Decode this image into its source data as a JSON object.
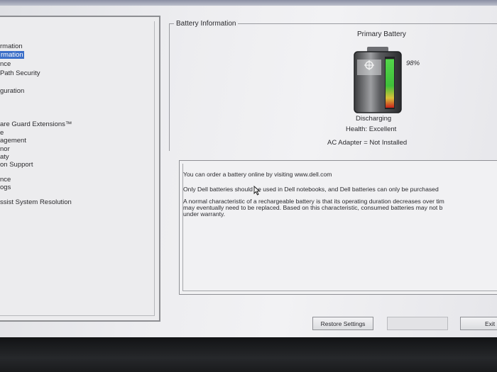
{
  "nav": {
    "items": [
      {
        "label": "rmation",
        "selected": false
      },
      {
        "label": "rmation",
        "selected": true
      },
      {
        "label": "nce",
        "selected": false
      },
      {
        "label": "Path Security",
        "selected": false
      },
      {
        "label": "guration",
        "selected": false
      },
      {
        "label": "are Guard Extensions™",
        "selected": false
      },
      {
        "label": "e",
        "selected": false
      },
      {
        "label": "agement",
        "selected": false
      },
      {
        "label": "nor",
        "selected": false
      },
      {
        "label": "aty",
        "selected": false
      },
      {
        "label": "on Support",
        "selected": false
      },
      {
        "label": "nce",
        "selected": false
      },
      {
        "label": "ogs",
        "selected": false
      },
      {
        "label": "ssist System Resolution",
        "selected": false
      }
    ]
  },
  "battery_info": {
    "group_title": "Battery Information",
    "battery_label": "Primary Battery",
    "charge_percent": "98%",
    "charge_level": 0.98,
    "state": "Discharging",
    "health": "Health: Excellent",
    "ac_adapter": "AC Adapter = Not Installed"
  },
  "message": {
    "lines": [
      "You can order a battery online by visiting www.dell.com",
      "Only Dell batteries should be used in Dell notebooks, and Dell batteries can only be purchased",
      "A normal characteristic of a rechargeable battery is that its operating duration decreases over tim",
      "may eventually need to be replaced.  Based on this characteristic, consumed batteries may not b",
      "under warranty."
    ]
  },
  "buttons": {
    "restore": "Restore Settings",
    "exit": "Exit"
  },
  "colors": {
    "selection": "#3c6fc8",
    "battery_green": "#3fbf3a",
    "battery_red": "#c8231c"
  }
}
